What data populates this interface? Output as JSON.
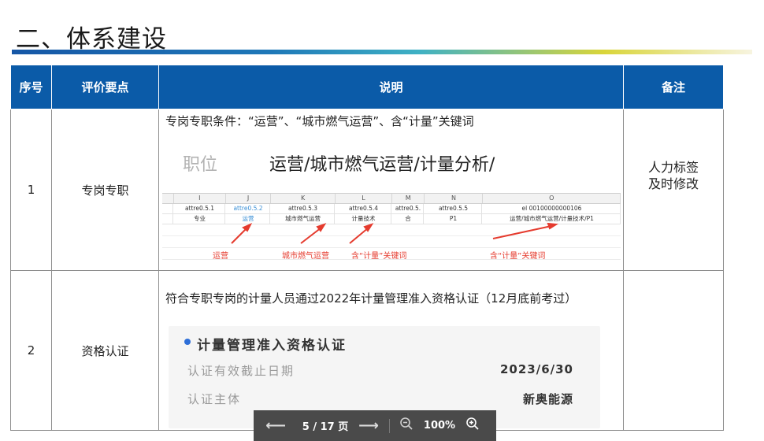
{
  "page": {
    "title": "二、体系建设"
  },
  "table": {
    "headers": [
      "序号",
      "评价要点",
      "说明",
      "备注"
    ],
    "row1": {
      "num": "1",
      "point": "专岗专职",
      "desc": "专岗专职条件：“运营”、“城市燃气运营”、含“计量”关键词",
      "pos_label": "职位",
      "pos_value": "运营/城市燃气运营/计量分析/",
      "sheet": {
        "columns": [
          "I",
          "J",
          "K",
          "L",
          "M",
          "N",
          "O"
        ],
        "attrs": [
          "attre0.5.1",
          "attre0.5.2",
          "attre0.5.3",
          "attre0.5.4",
          "attre0.5.",
          "attre0.5.5",
          "el 00100000000106"
        ],
        "values": [
          "专业",
          "运营",
          "城市燃气运营",
          "计量技术",
          "合",
          "P1",
          "运营/城市燃气运营/计量技术/P1"
        ]
      },
      "annotations": [
        "运营",
        "城市燃气运营",
        "含“计量”关键词",
        "含“计量”关键词"
      ],
      "remark": "人力标签及时修改"
    },
    "row2": {
      "num": "2",
      "point": "资格认证",
      "desc": "符合专职专岗的计量人员通过2022年计量管理准入资格认证（12月底前考过）",
      "card": {
        "title": "计量管理准入资格认证",
        "expiry_label": "认证有效截止日期",
        "expiry_value": "2023/6/30",
        "subject_label": "认证主体",
        "subject_value": "新奥能源"
      }
    }
  },
  "pager": {
    "page": "5 / 17 页",
    "zoom": "100%",
    "prev_icon": "arrow-left-icon",
    "next_icon": "arrow-right-icon",
    "zoom_out_icon": "zoom-out-icon",
    "zoom_in_icon": "zoom-in-icon"
  }
}
